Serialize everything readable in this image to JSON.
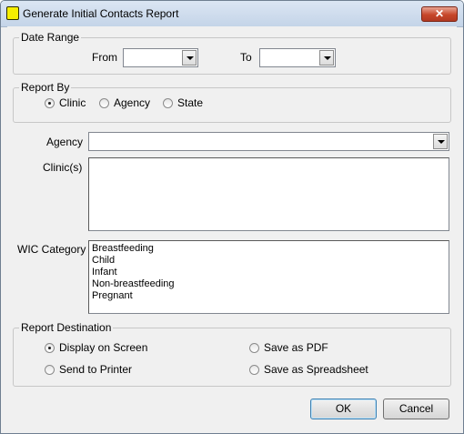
{
  "window": {
    "title": "Generate Initial Contacts Report",
    "close_label": "✕"
  },
  "date_range": {
    "legend": "Date Range",
    "from_label": "From",
    "to_label": "To",
    "from_value": "",
    "to_value": ""
  },
  "report_by": {
    "legend": "Report By",
    "options": [
      "Clinic",
      "Agency",
      "State"
    ],
    "selected": "Clinic"
  },
  "agency": {
    "label": "Agency",
    "value": ""
  },
  "clinics": {
    "label": "Clinic(s)",
    "items": []
  },
  "wic_category": {
    "label": "WIC Category",
    "items": [
      "Breastfeeding",
      "Child",
      "Infant",
      "Non-breastfeeding",
      "Pregnant"
    ]
  },
  "report_destination": {
    "legend": "Report Destination",
    "options": [
      "Display on Screen",
      "Send to Printer",
      "Save as PDF",
      "Save as Spreadsheet"
    ],
    "selected": "Display on Screen"
  },
  "buttons": {
    "ok": "OK",
    "cancel": "Cancel"
  }
}
